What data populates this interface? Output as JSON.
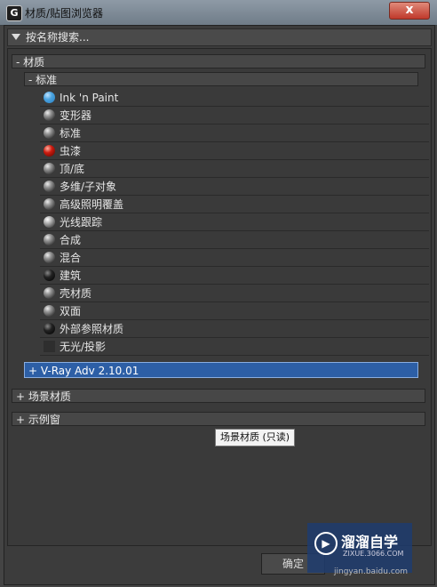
{
  "window": {
    "title": "材质/贴图浏览器",
    "app_icon": "G",
    "close_glyph": "x"
  },
  "search": {
    "placeholder": "按名称搜索..."
  },
  "groups": {
    "materials": "- 材质",
    "standard": "- 标准",
    "vray": "+ V-Ray Adv 2.10.01",
    "scene": "+ 场景材质",
    "samples": "+ 示例窗"
  },
  "items": [
    {
      "label": "Ink 'n Paint",
      "icon": "blue-sphere-icon"
    },
    {
      "label": "变形器",
      "icon": "gray-sphere-icon"
    },
    {
      "label": "标准",
      "icon": "gray-sphere-icon"
    },
    {
      "label": "虫漆",
      "icon": "red-sphere-icon"
    },
    {
      "label": "顶/底",
      "icon": "gray-sphere-icon"
    },
    {
      "label": "多维/子对象",
      "icon": "gray-sphere-icon"
    },
    {
      "label": "高级照明覆盖",
      "icon": "gray-sphere-icon"
    },
    {
      "label": "光线跟踪",
      "icon": "bw-sphere-icon"
    },
    {
      "label": "合成",
      "icon": "gray-sphere-icon"
    },
    {
      "label": "混合",
      "icon": "gray-sphere-icon"
    },
    {
      "label": "建筑",
      "icon": "black-sphere-icon"
    },
    {
      "label": "壳材质",
      "icon": "gray-sphere-icon"
    },
    {
      "label": "双面",
      "icon": "gray-sphere-icon"
    },
    {
      "label": "外部参照材质",
      "icon": "black-sphere-icon"
    },
    {
      "label": "无光/投影",
      "icon": "square-swatch-icon"
    }
  ],
  "tooltip": "场景材质 (只读)",
  "buttons": {
    "ok": "确定"
  },
  "watermark": {
    "logo": "▶",
    "title": "溜溜自学",
    "sub": "ZIXUE.3066.COM",
    "site": "jingyan.baidu.com"
  }
}
